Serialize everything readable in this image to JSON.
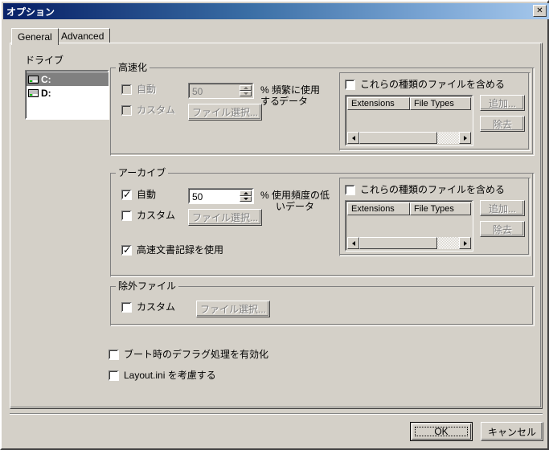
{
  "window": {
    "title": "オプション",
    "close_label": "✕",
    "titlebar_color_start": "#0a246a",
    "titlebar_color_end": "#a6c8ec",
    "face_color": "#d4d0c8"
  },
  "tabs": [
    {
      "label": "General",
      "active": true
    },
    {
      "label": "Advanced",
      "active": false
    }
  ],
  "drives": {
    "label": "ドライブ",
    "items": [
      {
        "label": "C:",
        "selected": true
      },
      {
        "label": "D:",
        "selected": false
      }
    ]
  },
  "accel_group": {
    "title": "高速化",
    "auto": {
      "label": "自動",
      "checked": false,
      "enabled": false
    },
    "spinner": {
      "value": "50",
      "enabled": false
    },
    "percent_label_line1": "% 頻繁に使用する",
    "percent_label_line2": "データ",
    "custom": {
      "label": "カスタム",
      "checked": false,
      "enabled": false
    },
    "file_select_button": {
      "label": "ファイル選択...",
      "enabled": false
    },
    "include_types": {
      "checkbox_label": "これらの種類のファイルを含める",
      "checked": false,
      "columns": [
        "Extensions",
        "File Types"
      ],
      "rows": [],
      "add_button": {
        "label": "追加...",
        "enabled": false
      },
      "remove_button": {
        "label": "除去",
        "enabled": false
      }
    }
  },
  "archive_group": {
    "title": "アーカイブ",
    "auto": {
      "label": "自動",
      "checked": true,
      "enabled": true
    },
    "spinner": {
      "value": "50",
      "enabled": true
    },
    "percent_label_line1": "% 使用頻度の低",
    "percent_label_line2": "いデータ",
    "custom": {
      "label": "カスタム",
      "checked": false,
      "enabled": true
    },
    "file_select_button": {
      "label": "ファイル選択...",
      "enabled": false
    },
    "fast_doc_record": {
      "label": "高速文書記録を使用",
      "checked": true
    },
    "include_types": {
      "checkbox_label": "これらの種類のファイルを含める",
      "checked": false,
      "columns": [
        "Extensions",
        "File Types"
      ],
      "rows": [],
      "add_button": {
        "label": "追加...",
        "enabled": false
      },
      "remove_button": {
        "label": "除去",
        "enabled": false
      }
    }
  },
  "exclude_group": {
    "title": "除外ファイル",
    "custom": {
      "label": "カスタム",
      "checked": false,
      "enabled": true
    },
    "file_select_button": {
      "label": "ファイル選択...",
      "enabled": false
    }
  },
  "bottom_options": [
    {
      "label": "ブート時のデフラグ処理を有効化",
      "checked": false
    },
    {
      "label": "Layout.ini を考慮する",
      "checked": false
    }
  ],
  "footer": {
    "ok_label": "OK",
    "cancel_label": "キャンセル"
  }
}
